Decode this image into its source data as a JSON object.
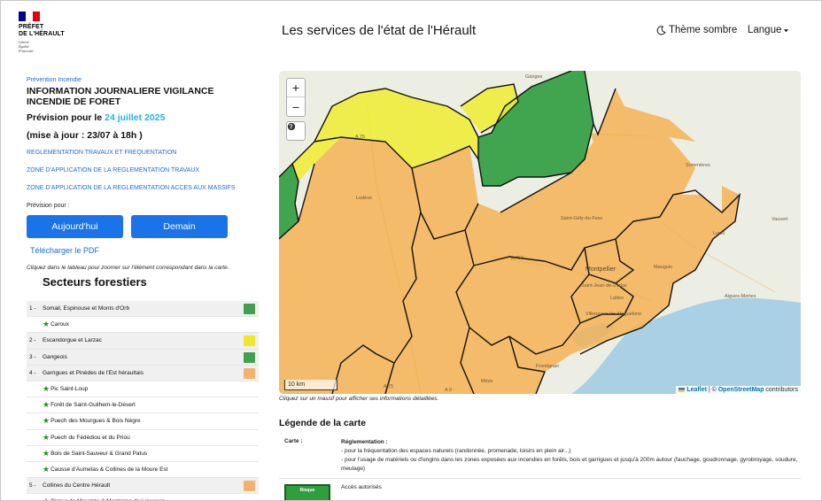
{
  "header": {
    "logo_lines": [
      "PRÉFET",
      "DE L'HÉRAULT"
    ],
    "logo_motto": [
      "Liberté",
      "Égalité",
      "Fraternité"
    ],
    "flag_colors": [
      "#000091",
      "#ffffff",
      "#e1000f"
    ],
    "site_title": "Les services de l'état de l'Hérault",
    "theme_label": "Thème sombre",
    "theme_icon": "moon-icon",
    "lang_label": "Langue",
    "lang_icon": "caret-down-icon"
  },
  "left": {
    "kicker": "Prévention Incendie",
    "title_line1": "INFORMATION JOURNALIERE VIGILANCE",
    "title_line2": "INCENDIE DE FORET",
    "forecast_prefix": "Prévision pour le",
    "forecast_date": "24 juillet 2025",
    "update": "(mise à jour : 23/07 à 18h )",
    "links": [
      "REGLEMENTATION TRAVAUX ET FREQUENTATION",
      "ZONE D'APPLICATION DE LA REGLEMENTATION TRAVAUX",
      "ZONE D'APPLICATION DE LA REGLEMENTATION ACCES AUX MASSIFS"
    ],
    "prevision_label": "Prévision pour :",
    "btn_today": "Aujourd'hui",
    "btn_tomorrow": "Demain",
    "pdf_link": "Télécharger le PDF",
    "hint": "Cliquez dans le tableau pour zoomer sur l'élément correspondant dans la carte.",
    "sectors_title": "Secteurs forestiers"
  },
  "colors": {
    "green": "#3fa34d",
    "yellow": "#f2e52a",
    "orange": "#f4b36c",
    "accent": "#1a73e8",
    "date": "#27b0e6"
  },
  "sectors": [
    {
      "num": "1 -",
      "label": "Somail, Espinouse et Monts d'Orb",
      "sub": false,
      "color": "#3fa34d"
    },
    {
      "num": "",
      "label": "Caroux",
      "sub": true,
      "color": ""
    },
    {
      "num": "2 -",
      "label": "Escandorgue et Larzac",
      "sub": false,
      "color": "#f2e52a"
    },
    {
      "num": "3 -",
      "label": "Gangeois",
      "sub": false,
      "color": "#3fa34d"
    },
    {
      "num": "4 -",
      "label": "Garrigues et Pinèdes de l'Est héraultais",
      "sub": false,
      "color": "#f4b36c"
    },
    {
      "num": "",
      "label": "Pic Saint-Loup",
      "sub": true,
      "color": ""
    },
    {
      "num": "",
      "label": "Forêt de Saint-Guilhem-le-Désert",
      "sub": true,
      "color": ""
    },
    {
      "num": "",
      "label": "Puech des Mourgues & Bois Nègre",
      "sub": true,
      "color": ""
    },
    {
      "num": "",
      "label": "Puech du Fédédiou et du Priou",
      "sub": true,
      "color": ""
    },
    {
      "num": "",
      "label": "Bois de Saint-Sauveur & Grand Patus",
      "sub": true,
      "color": ""
    },
    {
      "num": "",
      "label": "Causse d'Aumelas & Collines de la Moure Est",
      "sub": true,
      "color": ""
    },
    {
      "num": "5 -",
      "label": "Collines du Centre Hérault",
      "sub": false,
      "color": "#f4b36c"
    },
    {
      "num": "",
      "label": "Cirque de Mourèze & Montagne de Liausson",
      "sub": true,
      "color": ""
    }
  ],
  "map": {
    "zoom_in": "+",
    "zoom_out": "−",
    "scale": "10 km",
    "attribution_leaflet": "Leaflet",
    "attribution_sep": " | © ",
    "attribution_osm": "OpenStreetMap",
    "attribution_tail": " contributors",
    "labels": [
      {
        "text": "Ganges",
        "cls": ""
      },
      {
        "text": "A 75",
        "cls": ""
      },
      {
        "text": "Sommières",
        "cls": ""
      },
      {
        "text": "Lodève",
        "cls": ""
      },
      {
        "text": "Saint-Gély-du-Fesc",
        "cls": ""
      },
      {
        "text": "Vauvert",
        "cls": ""
      },
      {
        "text": "Lunel",
        "cls": ""
      },
      {
        "text": "A 750",
        "cls": ""
      },
      {
        "text": "Montpellier",
        "cls": "city"
      },
      {
        "text": "Mauguio",
        "cls": ""
      },
      {
        "text": "Lattes",
        "cls": ""
      },
      {
        "text": "Aigues-Mortes",
        "cls": ""
      },
      {
        "text": "Saint-Jean-de-Védas",
        "cls": ""
      },
      {
        "text": "Villeneuve-lès-Maguelone",
        "cls": ""
      },
      {
        "text": "Frontignan",
        "cls": ""
      },
      {
        "text": "Mèze",
        "cls": ""
      },
      {
        "text": "A 75",
        "cls": ""
      },
      {
        "text": "A 9",
        "cls": ""
      }
    ]
  },
  "map_hint": "Cliquez sur un massif pour afficher ses informations détaillées.",
  "legend": {
    "title": "Légende de la carte",
    "row1_key": "Carte :",
    "row1_head": "Réglementation :",
    "row1_line1": "- pour la fréquentation des espaces naturels (randonnée, promenade, loisirs en plein air...)",
    "row1_line2": "- pour l'usage de matériels ou d'engins dans les zones exposées aux incendies en forêts, bois et garrigues et jusqu'à 200m autour (fauchage, goudronnage, gyrobroyage, soudure, meulage)",
    "row2_box": "Risque",
    "row2_text": "Accès autorisés"
  }
}
